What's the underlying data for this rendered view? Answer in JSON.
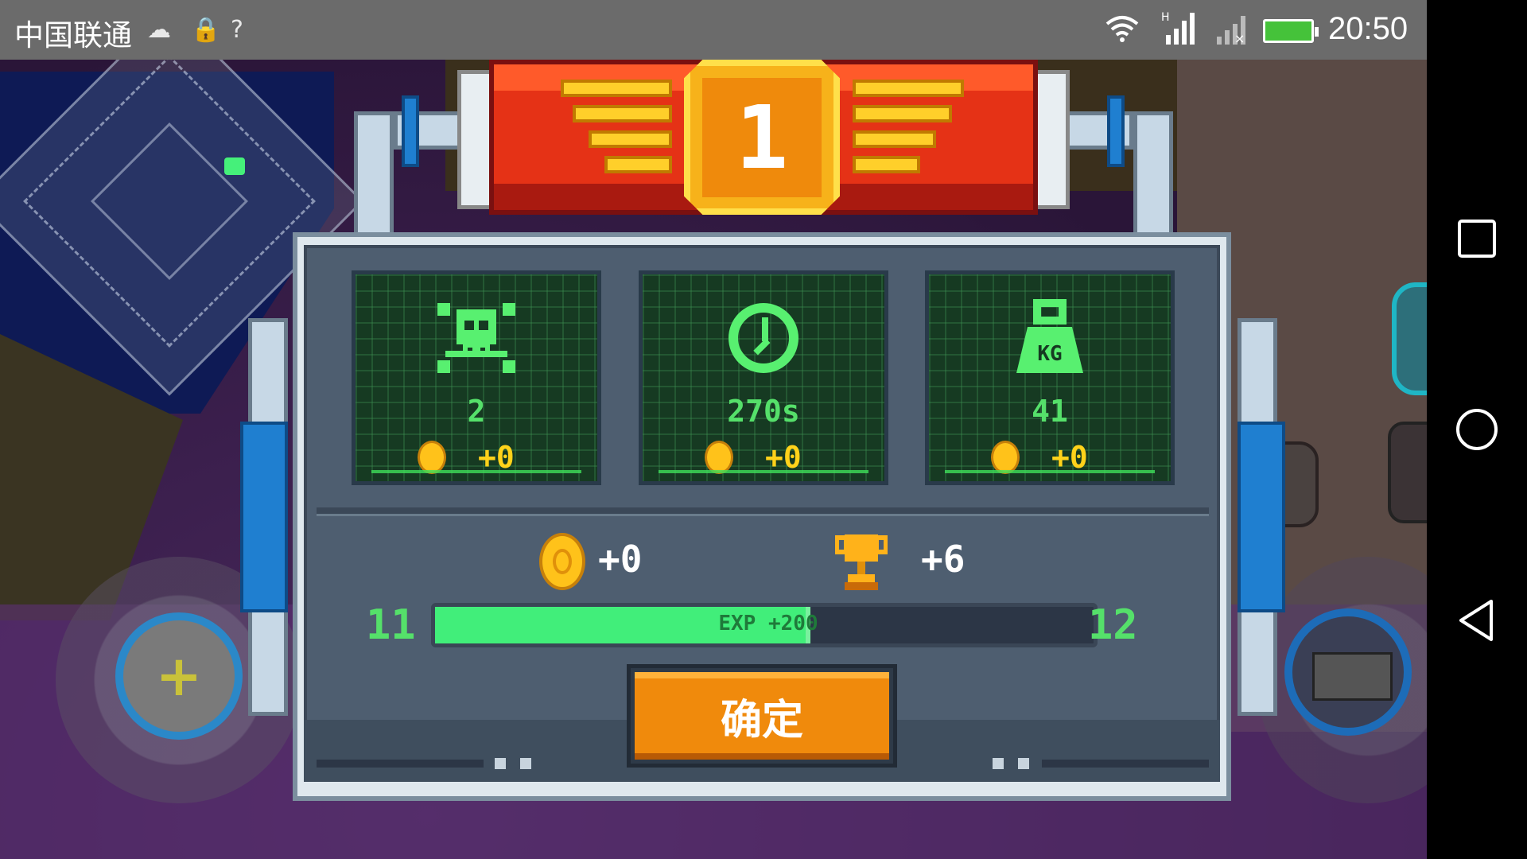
{
  "status_bar": {
    "carrier": "中国联通",
    "time": "20:50"
  },
  "result": {
    "rank": "1",
    "stats": [
      {
        "icon": "skull-crossbones-icon",
        "value": "2",
        "coin_reward": "+0"
      },
      {
        "icon": "clock-icon",
        "value": "270s",
        "coin_reward": "+0"
      },
      {
        "icon": "weight-icon",
        "value": "41",
        "coin_reward": "+0"
      }
    ],
    "summary": {
      "coins": "+0",
      "trophies": "+6"
    },
    "level": {
      "current": "11",
      "next": "12",
      "exp_label": "EXP +200",
      "progress": 0.57
    },
    "confirm_label": "确定",
    "weight_icon_text": "KG"
  },
  "colors": {
    "accent_green": "#41ee7a",
    "coin_gold": "#ffc21a",
    "banner_red": "#e53216",
    "confirm_orange": "#f08a0c"
  }
}
